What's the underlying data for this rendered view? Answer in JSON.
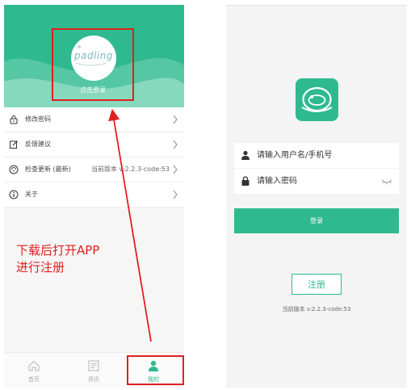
{
  "left_screen": {
    "header": {
      "logo_text": "padling",
      "login_hint": "点击登录"
    },
    "menu": [
      {
        "icon": "lock-icon",
        "label": "修改密码",
        "value": ""
      },
      {
        "icon": "edit-icon",
        "label": "反馈建议",
        "value": ""
      },
      {
        "icon": "update-icon",
        "label": "检查更新 (最新)",
        "value": "当前版本   v:2.2.3-code:53"
      },
      {
        "icon": "info-icon",
        "label": "关于",
        "value": ""
      }
    ],
    "tabs": [
      {
        "icon": "home-icon",
        "label": "首页",
        "active": false
      },
      {
        "icon": "news-icon",
        "label": "资讯",
        "active": false
      },
      {
        "icon": "user-icon",
        "label": "我的",
        "active": true
      }
    ]
  },
  "annotation": {
    "note_line1": "下载后打开APP",
    "note_line2": "进行注册",
    "color": "#e02020"
  },
  "right_screen": {
    "username_placeholder": "请输入用户名/手机号",
    "password_placeholder": "请输入密码",
    "login_label": "登录",
    "register_label": "注册",
    "version_text": "当前版本  v:2.2.3-code:53"
  },
  "colors": {
    "brand": "#2fb98f",
    "annotation": "#e02020"
  }
}
